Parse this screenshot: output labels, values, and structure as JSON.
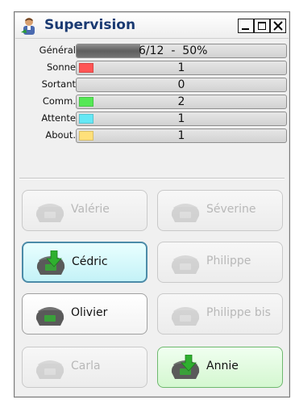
{
  "window": {
    "title": "Supervision"
  },
  "stats": {
    "general": {
      "label": "Général",
      "text": "6/12  -  50%",
      "progress_fraction": 0.5
    },
    "rows": [
      {
        "label": "Sonne",
        "value": "1",
        "swatch": "#ff5555"
      },
      {
        "label": "Sortant",
        "value": "0",
        "swatch": ""
      },
      {
        "label": "Comm.",
        "value": "2",
        "swatch": "#55e855"
      },
      {
        "label": "Attente",
        "value": "1",
        "swatch": "#66e8f5"
      },
      {
        "label": "About.",
        "value": "1",
        "swatch": "#ffe07a"
      }
    ]
  },
  "contacts": [
    {
      "name": "Valérie",
      "state": "disabled"
    },
    {
      "name": "Séverine",
      "state": "disabled"
    },
    {
      "name": "Cédric",
      "state": "talking"
    },
    {
      "name": "Philippe",
      "state": "disabled"
    },
    {
      "name": "Olivier",
      "state": "available"
    },
    {
      "name": "Philippe bis",
      "state": "disabled"
    },
    {
      "name": "Carla",
      "state": "disabled"
    },
    {
      "name": "Annie",
      "state": "talking-green"
    }
  ],
  "icons": {
    "app": "supervisor-icon",
    "minimize": "minimize-icon",
    "maximize": "maximize-icon",
    "close": "close-icon",
    "phone": "phone-icon"
  }
}
